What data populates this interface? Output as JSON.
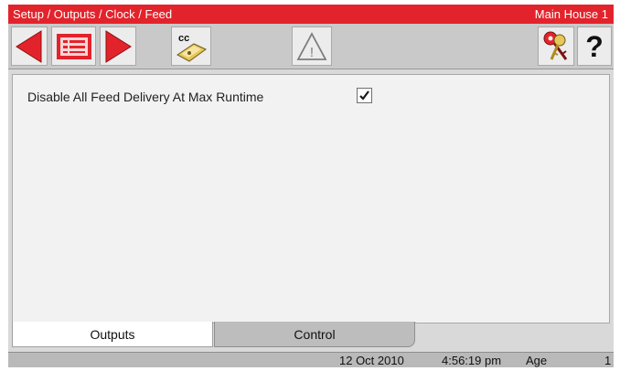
{
  "titlebar": {
    "breadcrumb": "Setup / Outputs / Clock / Feed",
    "location": "Main House 1"
  },
  "toolbar": {
    "back_icon": "left-arrow-icon",
    "menu_icon": "menu-list-icon",
    "forward_icon": "right-arrow-icon",
    "copy_icon": "cc-copy-icon",
    "copy_text": "cc",
    "alarm_icon": "warning-triangle-icon",
    "alarm_text": "!",
    "keys_icon": "keys-icon",
    "help_icon": "help-icon",
    "help_text": "?"
  },
  "settings": {
    "disable_feed_label": "Disable All Feed Delivery At Max Runtime",
    "disable_feed_checked": true
  },
  "tabs": [
    {
      "label": "Outputs",
      "active": true
    },
    {
      "label": "Control",
      "active": false
    }
  ],
  "status": {
    "date": "12 Oct 2010",
    "time": "4:56:19 pm",
    "age_label": "Age",
    "age_value": "1"
  },
  "colors": {
    "title_bar": "#e3232b",
    "arrow_red": "#e3232b"
  }
}
